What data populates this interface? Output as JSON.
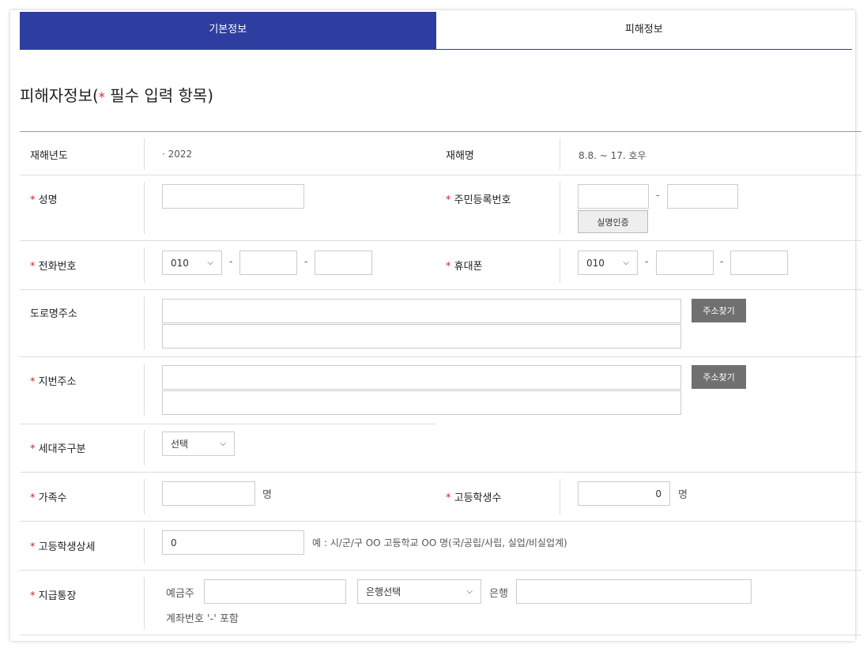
{
  "tabs": [
    {
      "label": "기본정보",
      "active": true
    },
    {
      "label": "피해정보",
      "active": false
    }
  ],
  "section_title_prefix": "피해자정보(",
  "section_title_star": "*",
  "section_title_suffix": " 필수 입력 항목)",
  "required_mark": "*",
  "colors": {
    "accent": "#2e3ea0",
    "required": "#e02020",
    "search_button": "#707070"
  },
  "rows": {
    "disaster_year": {
      "label": "재해년도",
      "value": "· 2022"
    },
    "disaster_name": {
      "label": "재해명",
      "value": "8.8. ~ 17. 호우"
    },
    "name": {
      "label": "성명",
      "value": ""
    },
    "resident_number": {
      "label": "주민등록번호",
      "part1": "",
      "part2": "",
      "verify_button": "실명인증"
    },
    "phone": {
      "label": "전화번호",
      "prefix": "010",
      "mid": "",
      "last": ""
    },
    "mobile": {
      "label": "휴대폰",
      "prefix": "010",
      "mid": "",
      "last": ""
    },
    "road_address": {
      "label": "도로명주소",
      "line1": "",
      "line2": "",
      "search_button": "주소찾기"
    },
    "lot_address": {
      "label": "지번주소",
      "line1": "",
      "line2": "",
      "search_button": "주소찾기"
    },
    "household_type": {
      "label": "세대주구분",
      "selected": "선택"
    },
    "family_count": {
      "label": "가족수",
      "value": "",
      "unit": "명"
    },
    "hs_students": {
      "label": "고등학생수",
      "value": "0",
      "unit": "명"
    },
    "hs_detail": {
      "label": "고등학생상세",
      "value": "0",
      "example": "예 : 시/군/구 OO 고등학교 OO 명(국/공립/사립, 실업/비실업계)"
    },
    "bank_account": {
      "label": "지급통장",
      "holder_label": "예금주",
      "holder": "",
      "bank_selected": "은행선택",
      "bank_suffix": "은행",
      "account": "",
      "hint": "계좌번호 '-' 포함"
    }
  }
}
